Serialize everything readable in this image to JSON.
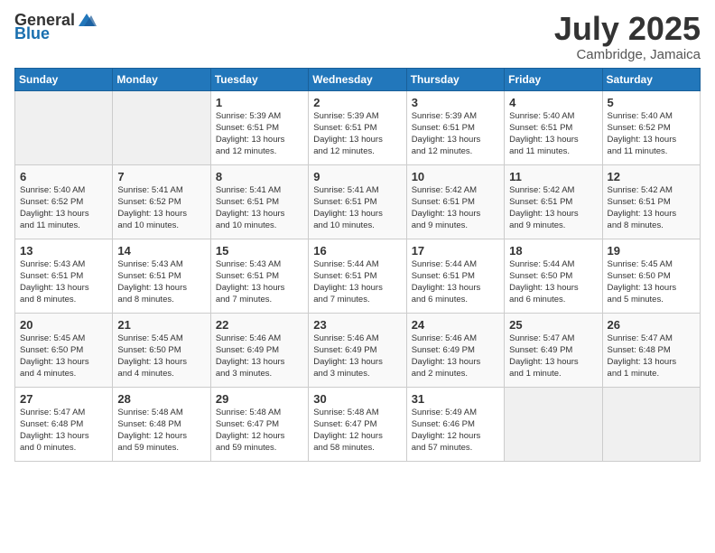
{
  "header": {
    "logo_general": "General",
    "logo_blue": "Blue",
    "month_title": "July 2025",
    "subtitle": "Cambridge, Jamaica"
  },
  "days_of_week": [
    "Sunday",
    "Monday",
    "Tuesday",
    "Wednesday",
    "Thursday",
    "Friday",
    "Saturday"
  ],
  "weeks": [
    [
      {
        "day": "",
        "info": ""
      },
      {
        "day": "",
        "info": ""
      },
      {
        "day": "1",
        "info": "Sunrise: 5:39 AM\nSunset: 6:51 PM\nDaylight: 13 hours\nand 12 minutes."
      },
      {
        "day": "2",
        "info": "Sunrise: 5:39 AM\nSunset: 6:51 PM\nDaylight: 13 hours\nand 12 minutes."
      },
      {
        "day": "3",
        "info": "Sunrise: 5:39 AM\nSunset: 6:51 PM\nDaylight: 13 hours\nand 12 minutes."
      },
      {
        "day": "4",
        "info": "Sunrise: 5:40 AM\nSunset: 6:51 PM\nDaylight: 13 hours\nand 11 minutes."
      },
      {
        "day": "5",
        "info": "Sunrise: 5:40 AM\nSunset: 6:52 PM\nDaylight: 13 hours\nand 11 minutes."
      }
    ],
    [
      {
        "day": "6",
        "info": "Sunrise: 5:40 AM\nSunset: 6:52 PM\nDaylight: 13 hours\nand 11 minutes."
      },
      {
        "day": "7",
        "info": "Sunrise: 5:41 AM\nSunset: 6:52 PM\nDaylight: 13 hours\nand 10 minutes."
      },
      {
        "day": "8",
        "info": "Sunrise: 5:41 AM\nSunset: 6:51 PM\nDaylight: 13 hours\nand 10 minutes."
      },
      {
        "day": "9",
        "info": "Sunrise: 5:41 AM\nSunset: 6:51 PM\nDaylight: 13 hours\nand 10 minutes."
      },
      {
        "day": "10",
        "info": "Sunrise: 5:42 AM\nSunset: 6:51 PM\nDaylight: 13 hours\nand 9 minutes."
      },
      {
        "day": "11",
        "info": "Sunrise: 5:42 AM\nSunset: 6:51 PM\nDaylight: 13 hours\nand 9 minutes."
      },
      {
        "day": "12",
        "info": "Sunrise: 5:42 AM\nSunset: 6:51 PM\nDaylight: 13 hours\nand 8 minutes."
      }
    ],
    [
      {
        "day": "13",
        "info": "Sunrise: 5:43 AM\nSunset: 6:51 PM\nDaylight: 13 hours\nand 8 minutes."
      },
      {
        "day": "14",
        "info": "Sunrise: 5:43 AM\nSunset: 6:51 PM\nDaylight: 13 hours\nand 8 minutes."
      },
      {
        "day": "15",
        "info": "Sunrise: 5:43 AM\nSunset: 6:51 PM\nDaylight: 13 hours\nand 7 minutes."
      },
      {
        "day": "16",
        "info": "Sunrise: 5:44 AM\nSunset: 6:51 PM\nDaylight: 13 hours\nand 7 minutes."
      },
      {
        "day": "17",
        "info": "Sunrise: 5:44 AM\nSunset: 6:51 PM\nDaylight: 13 hours\nand 6 minutes."
      },
      {
        "day": "18",
        "info": "Sunrise: 5:44 AM\nSunset: 6:50 PM\nDaylight: 13 hours\nand 6 minutes."
      },
      {
        "day": "19",
        "info": "Sunrise: 5:45 AM\nSunset: 6:50 PM\nDaylight: 13 hours\nand 5 minutes."
      }
    ],
    [
      {
        "day": "20",
        "info": "Sunrise: 5:45 AM\nSunset: 6:50 PM\nDaylight: 13 hours\nand 4 minutes."
      },
      {
        "day": "21",
        "info": "Sunrise: 5:45 AM\nSunset: 6:50 PM\nDaylight: 13 hours\nand 4 minutes."
      },
      {
        "day": "22",
        "info": "Sunrise: 5:46 AM\nSunset: 6:49 PM\nDaylight: 13 hours\nand 3 minutes."
      },
      {
        "day": "23",
        "info": "Sunrise: 5:46 AM\nSunset: 6:49 PM\nDaylight: 13 hours\nand 3 minutes."
      },
      {
        "day": "24",
        "info": "Sunrise: 5:46 AM\nSunset: 6:49 PM\nDaylight: 13 hours\nand 2 minutes."
      },
      {
        "day": "25",
        "info": "Sunrise: 5:47 AM\nSunset: 6:49 PM\nDaylight: 13 hours\nand 1 minute."
      },
      {
        "day": "26",
        "info": "Sunrise: 5:47 AM\nSunset: 6:48 PM\nDaylight: 13 hours\nand 1 minute."
      }
    ],
    [
      {
        "day": "27",
        "info": "Sunrise: 5:47 AM\nSunset: 6:48 PM\nDaylight: 13 hours\nand 0 minutes."
      },
      {
        "day": "28",
        "info": "Sunrise: 5:48 AM\nSunset: 6:48 PM\nDaylight: 12 hours\nand 59 minutes."
      },
      {
        "day": "29",
        "info": "Sunrise: 5:48 AM\nSunset: 6:47 PM\nDaylight: 12 hours\nand 59 minutes."
      },
      {
        "day": "30",
        "info": "Sunrise: 5:48 AM\nSunset: 6:47 PM\nDaylight: 12 hours\nand 58 minutes."
      },
      {
        "day": "31",
        "info": "Sunrise: 5:49 AM\nSunset: 6:46 PM\nDaylight: 12 hours\nand 57 minutes."
      },
      {
        "day": "",
        "info": ""
      },
      {
        "day": "",
        "info": ""
      }
    ]
  ],
  "accent_color": "#2277bb"
}
